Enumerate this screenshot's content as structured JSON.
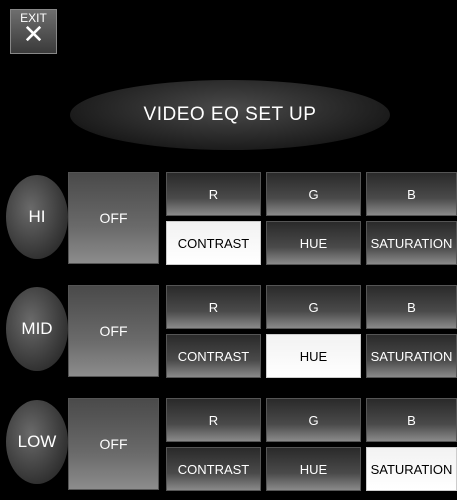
{
  "exit": {
    "label": "EXIT",
    "icon": "close-icon",
    "glyph": "✕"
  },
  "title": "VIDEO EQ SET UP",
  "rows": [
    {
      "label": "HI",
      "off": "OFF",
      "r": "R",
      "g": "G",
      "b": "B",
      "contrast": "CONTRAST",
      "hue": "HUE",
      "saturation": "SATURATION",
      "selected": "contrast"
    },
    {
      "label": "MID",
      "off": "OFF",
      "r": "R",
      "g": "G",
      "b": "B",
      "contrast": "CONTRAST",
      "hue": "HUE",
      "saturation": "SATURATION",
      "selected": "hue"
    },
    {
      "label": "LOW",
      "off": "OFF",
      "r": "R",
      "g": "G",
      "b": "B",
      "contrast": "CONTRAST",
      "hue": "HUE",
      "saturation": "SATURATION",
      "selected": "saturation"
    }
  ]
}
